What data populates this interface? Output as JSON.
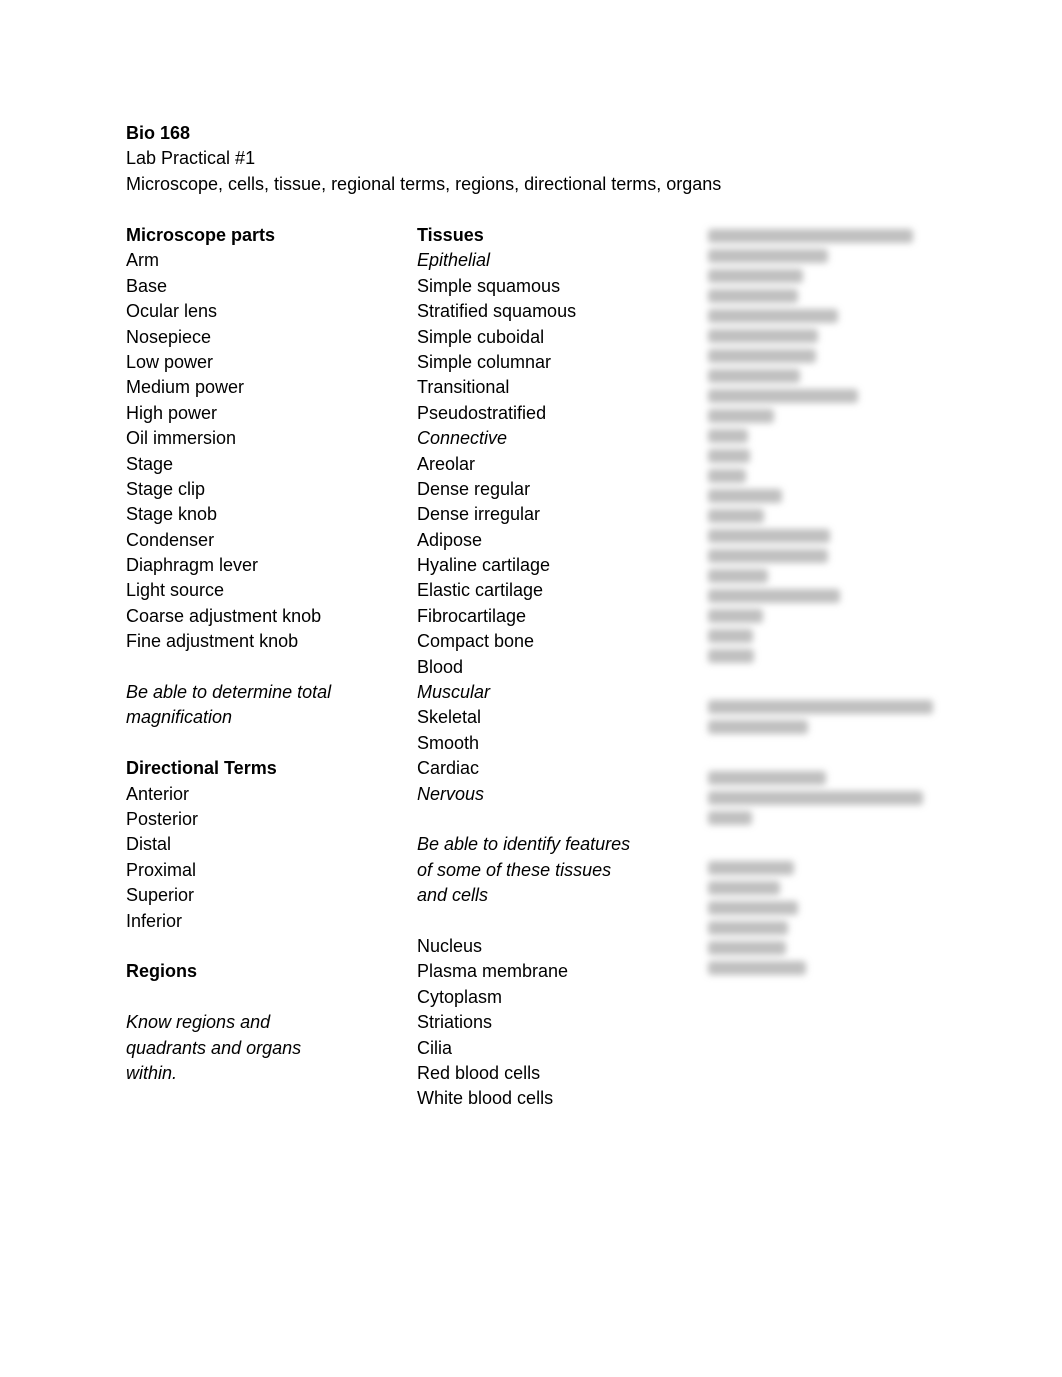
{
  "header": {
    "course": "Bio 168",
    "title": "Lab Practical #1",
    "subtitle": "Microscope, cells, tissue, regional terms, regions, directional terms, organs"
  },
  "column1": {
    "microscope_heading": "Microscope parts",
    "microscope_items": [
      "Arm",
      "Base",
      "Ocular lens",
      "Nosepiece",
      "Low power",
      "Medium power",
      "High power",
      "Oil immersion",
      "Stage",
      "Stage clip",
      "Stage knob",
      "Condenser",
      "Diaphragm lever",
      "Light source",
      "Coarse adjustment knob",
      "Fine adjustment knob"
    ],
    "magnification_note": [
      "Be able to determine total",
      "magnification"
    ],
    "directional_heading": "Directional Terms",
    "directional_items": [
      "Anterior",
      "Posterior",
      "Distal",
      "Proximal",
      "Superior",
      "Inferior"
    ],
    "regions_heading": "Regions",
    "regions_note": [
      "Know regions and",
      "quadrants and organs",
      "within."
    ]
  },
  "column2": {
    "tissues_heading": "Tissues",
    "epithelial_label": "Epithelial",
    "epithelial_items": [
      "Simple squamous",
      "Stratified squamous",
      "Simple cuboidal",
      "Simple columnar",
      "Transitional",
      "Pseudostratified"
    ],
    "connective_label": "Connective",
    "connective_items": [
      "Areolar",
      "Dense regular",
      "Dense irregular",
      "Adipose",
      "Hyaline cartilage",
      "Elastic cartilage",
      "Fibrocartilage",
      "Compact bone",
      "Blood"
    ],
    "muscular_label": "Muscular",
    "muscular_items": [
      "Skeletal",
      "Smooth",
      "Cardiac"
    ],
    "nervous_label": "Nervous",
    "features_note": [
      "Be able to identify features",
      "of some of these tissues",
      "and cells"
    ],
    "cell_features": [
      "Nucleus",
      "Plasma membrane",
      "Cytoplasm",
      "Striations",
      "Cilia",
      "Red blood cells",
      "White blood cells"
    ]
  },
  "column3": {
    "state": "blurred"
  }
}
